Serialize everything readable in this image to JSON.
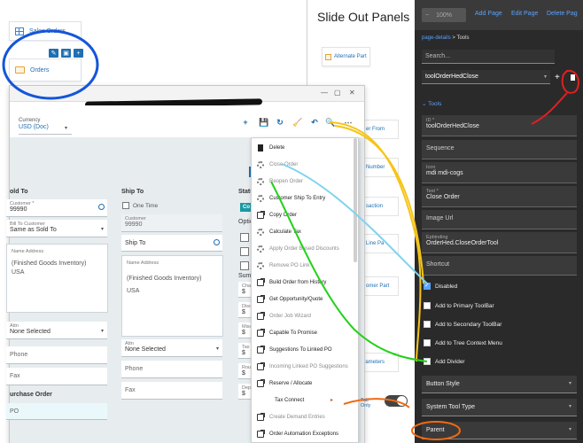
{
  "canvas": {
    "cards": {
      "sales_orders": "Sales Orders",
      "orders": "Orders"
    },
    "card_buttons": [
      "✎",
      "▣",
      "+"
    ],
    "slide_title": "Slide Out Panels",
    "slide_buttons": [
      "Alternate Part",
      "er From",
      "Number",
      "saction",
      "Line Pa",
      "omer Part",
      "Parameters"
    ]
  },
  "dialog": {
    "window_controls": [
      "—",
      "▢",
      "✕"
    ],
    "currency": {
      "label": "Currency",
      "value": "USD (Doc)"
    },
    "toolbar_icons": [
      "+",
      "💾",
      "↻",
      "🧹",
      "↶",
      "🔍"
    ],
    "sold_to": {
      "header": "old To",
      "customer_label": "Customer *",
      "customer_value": "99990",
      "bill_to_label": "Bill To Customer",
      "bill_to_value": "Same as Sold To",
      "name_address_label": "Name Address",
      "address_lines": [
        "(Finished Goods Inventory)",
        "",
        "USA"
      ],
      "attn_label": "Attn",
      "attn_value": "None Selected",
      "phone_placeholder": "Phone",
      "fax_placeholder": "Fax",
      "po_header": "urchase Order",
      "po_placeholder": "PO"
    },
    "ship_to": {
      "header": "Ship To",
      "one_time": "One Time",
      "customer_label": "Customer",
      "customer_value": "99990",
      "ship_to_placeholder": "Ship To",
      "name_address_label": "Name Address",
      "address_lines": [
        "(Finished Goods Inventory)",
        "",
        "USA"
      ],
      "attn_label": "Attn",
      "attn_value": "None Selected",
      "phone_placeholder": "Phone",
      "fax_placeholder": "Fax"
    },
    "status": {
      "header": "Statu",
      "badge": "Co",
      "options": "Optic",
      "summary": "Sumr",
      "rows": [
        "Cha",
        "Disc",
        "Misc",
        "Tax",
        "Rou",
        "Dep"
      ],
      "row_value": "$",
      "tab_only": "Tab Only"
    }
  },
  "context_menu": {
    "items": [
      {
        "label": "Delete",
        "icon": "trash-icon",
        "enabled": true
      },
      {
        "label": "Close Order",
        "icon": "gear-icon",
        "enabled": false
      },
      {
        "label": "Reopen Order",
        "icon": "gear-icon",
        "enabled": false
      },
      {
        "label": "Customer Ship To Entry",
        "icon": "gear-icon",
        "enabled": true
      },
      {
        "label": "Copy Order",
        "icon": "external-link-icon",
        "enabled": true
      },
      {
        "label": "Calculate Tax",
        "icon": "gear-icon",
        "enabled": true
      },
      {
        "label": "Apply Order Based Discounts",
        "icon": "gear-icon",
        "enabled": false
      },
      {
        "label": "Remove PO Link",
        "icon": "gear-icon",
        "enabled": false
      },
      {
        "label": "Build Order from History",
        "icon": "external-link-icon",
        "enabled": true
      },
      {
        "label": "Get Opportunity/Quote",
        "icon": "external-link-icon",
        "enabled": true
      },
      {
        "label": "Order Job Wizard",
        "icon": "external-link-icon",
        "enabled": false
      },
      {
        "label": "Capable To Promise",
        "icon": "external-link-icon",
        "enabled": true
      },
      {
        "label": "Suggestions To Linked PO",
        "icon": "external-link-icon",
        "enabled": true
      },
      {
        "label": "Incoming Linked PO Suggestions",
        "icon": "external-link-icon",
        "enabled": false
      },
      {
        "label": "Reserve / Allocate",
        "icon": "external-link-icon",
        "enabled": true
      },
      {
        "label": "Tax Connect",
        "icon": "",
        "enabled": true,
        "submenu": true
      },
      {
        "label": "Create Demand Entries",
        "icon": "external-link-icon",
        "enabled": false
      },
      {
        "label": "Order Automation Exceptions",
        "icon": "external-link-icon",
        "enabled": true
      }
    ],
    "submenu_arrow": "▸"
  },
  "props": {
    "topbar": {
      "zoom": "100%",
      "minus": "−",
      "add_page": "Add Page",
      "edit_page": "Edit Page",
      "delete_page": "Delete Pag"
    },
    "breadcrumb": {
      "parent": "page-details",
      "sep": ">",
      "current": "Tools"
    },
    "search_placeholder": "Search...",
    "selected_tool": "toolOrderHedClose",
    "section_tools": "Tools",
    "fields": [
      {
        "label": "ID *",
        "value": "toolOrderHedClose"
      },
      {
        "label": "",
        "value": "Sequence"
      },
      {
        "label": "Icon",
        "value": "mdi mdi-cogs"
      },
      {
        "label": "Text *",
        "value": "Close Order"
      },
      {
        "label": "",
        "value": "Image Url"
      },
      {
        "label": "Epbinding",
        "value": "OrderHed.CloseOrderTool"
      },
      {
        "label": "",
        "value": "Shortcut"
      }
    ],
    "checkboxes": [
      {
        "label": "Disabled",
        "checked": true
      },
      {
        "label": "Add to Primary ToolBar",
        "checked": false
      },
      {
        "label": "Add to Secondary ToolBar",
        "checked": false
      },
      {
        "label": "Add to Tree Context Menu",
        "checked": false
      },
      {
        "label": "Add Divider",
        "checked": false
      }
    ],
    "dropdowns": [
      "Button Style",
      "System Tool Type",
      "Parent"
    ],
    "accent": "#5aa3ff"
  },
  "colors": {
    "annotation_blue": "#1555d9",
    "annotation_red": "#e02020",
    "annotation_yellow": "#f5c518",
    "annotation_lightblue": "#7fd3f0",
    "annotation_green": "#22d11a",
    "annotation_orange": "#ef6a12"
  }
}
